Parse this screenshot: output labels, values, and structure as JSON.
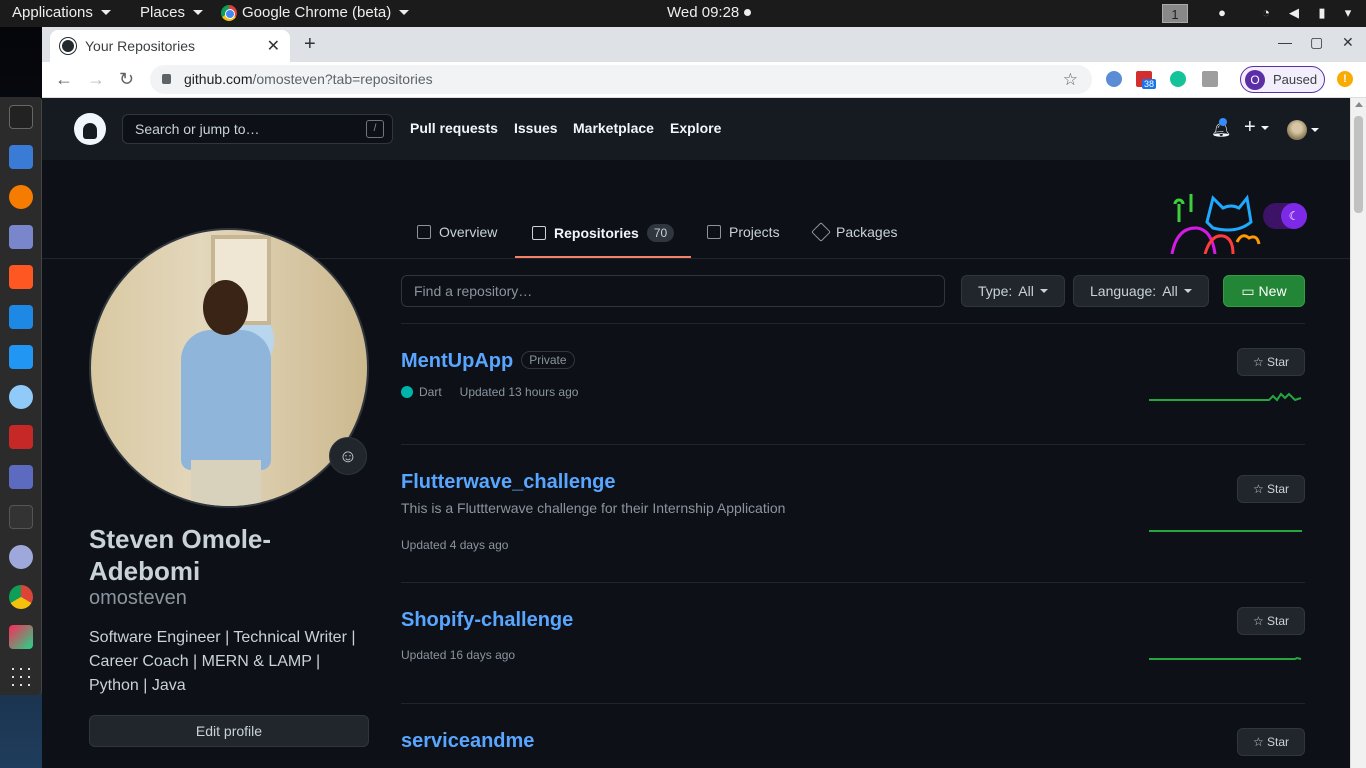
{
  "topbar": {
    "applications": "Applications",
    "places": "Places",
    "app_name": "Google Chrome (beta)",
    "clock": "Wed 09:28",
    "workspace": "1"
  },
  "browser": {
    "tab_title": "Your Repositories",
    "url_host": "github.com",
    "url_path": "/omosteven?tab=repositories",
    "extension_badge": "38",
    "profile_initial": "O",
    "profile_status": "Paused",
    "menu_alert": "!"
  },
  "gh_header": {
    "search_placeholder": "Search or jump to…",
    "search_hint": "/",
    "nav": [
      "Pull requests",
      "Issues",
      "Marketplace",
      "Explore"
    ]
  },
  "profile_tabs": [
    {
      "label": "Overview"
    },
    {
      "label": "Repositories",
      "count": "70",
      "selected": true
    },
    {
      "label": "Projects"
    },
    {
      "label": "Packages"
    }
  ],
  "profile": {
    "full_name": "Steven Omole-Adebomi",
    "login": "omosteven",
    "bio": "Software Engineer | Technical Writer | Career Coach | MERN & LAMP | Python | Java",
    "edit_label": "Edit profile",
    "emoji": "☺"
  },
  "filters": {
    "search_placeholder": "Find a repository…",
    "type_label": "Type:",
    "type_value": "All",
    "language_label": "Language:",
    "language_value": "All",
    "new_label": "New"
  },
  "repos": [
    {
      "name": "MentUpApp",
      "visibility": "Private",
      "description": "",
      "language": "Dart",
      "language_color": "#00b4ab",
      "updated": "Updated 13 hours ago",
      "star_label": "Star"
    },
    {
      "name": "Flutterwave_challenge",
      "visibility": "",
      "description": "This is a Fluttterwave challenge for their Internship Application",
      "language": "",
      "updated": "Updated 4 days ago",
      "star_label": "Star"
    },
    {
      "name": "Shopify-challenge",
      "visibility": "",
      "description": "",
      "language": "",
      "updated": "Updated 16 days ago",
      "star_label": "Star"
    },
    {
      "name": "serviceandme",
      "visibility": "",
      "description": "",
      "language": "",
      "updated": "",
      "star_label": "Star"
    }
  ],
  "colors": {
    "accent": "#f78166",
    "link": "#58a6ff",
    "new_button": "#238636",
    "page_bg": "#0d1117"
  }
}
